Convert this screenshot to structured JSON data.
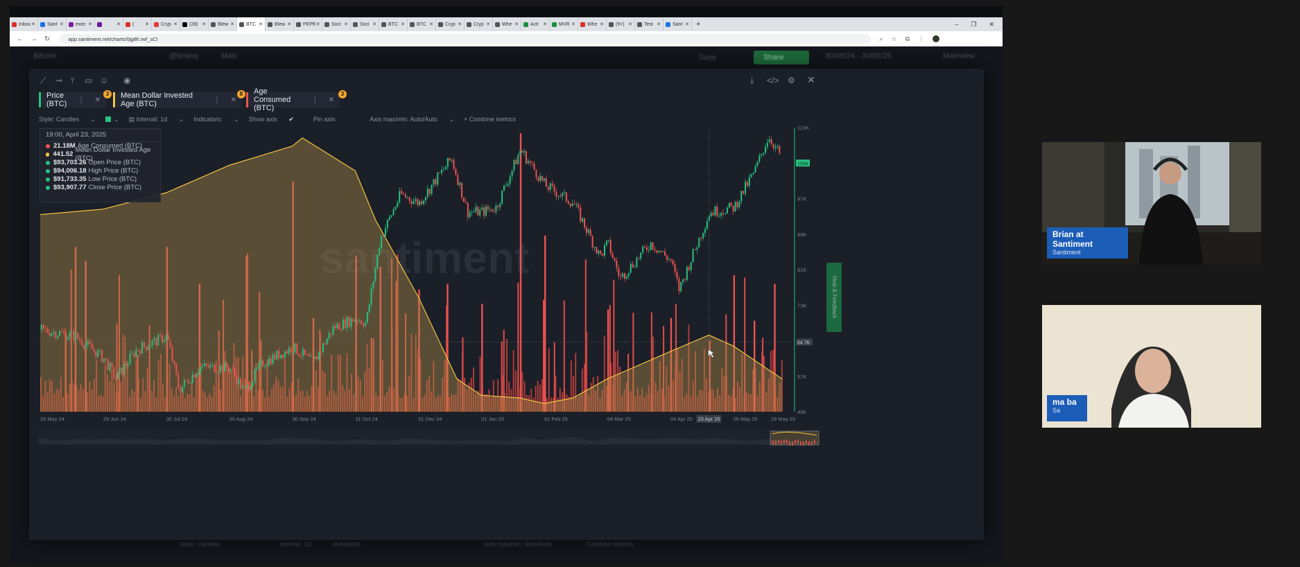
{
  "browser": {
    "tabs": [
      {
        "label": "Inbox",
        "color": "#d93025"
      },
      {
        "label": "Sant",
        "color": "#1a73e8"
      },
      {
        "label": "exec",
        "color": "#7b1fa2"
      },
      {
        "label": "",
        "color": "#6a1b9a"
      },
      {
        "label": "(",
        "color": "#d93025"
      },
      {
        "label": "Cryp",
        "color": "#e53935"
      },
      {
        "label": "(28)",
        "color": "#000000"
      },
      {
        "label": "Blew",
        "color": "#555555"
      },
      {
        "label": "BTC",
        "color": "#555555",
        "active": true
      },
      {
        "label": "Blew",
        "color": "#555555"
      },
      {
        "label": "PEPE",
        "color": "#555555"
      },
      {
        "label": "Soci",
        "color": "#555555"
      },
      {
        "label": "Soci",
        "color": "#555555"
      },
      {
        "label": "BTC",
        "color": "#555555"
      },
      {
        "label": "BTC",
        "color": "#555555"
      },
      {
        "label": "Cryp",
        "color": "#555555"
      },
      {
        "label": "Cryp",
        "color": "#555555"
      },
      {
        "label": "Whe",
        "color": "#555555"
      },
      {
        "label": "Acti",
        "color": "#1e8e3e"
      },
      {
        "label": "MVR",
        "color": "#1e8e3e"
      },
      {
        "label": "Whe",
        "color": "#d93025"
      },
      {
        "label": "(9+)",
        "color": "#555555"
      },
      {
        "label": "Test",
        "color": "#555555"
      },
      {
        "label": "Sant",
        "color": "#1a73e8"
      }
    ],
    "url": "app.santiment.net/charts/0jg8h.iwf_sCl"
  },
  "background_app": {
    "asset": "Bitcoin",
    "user": "@brianq",
    "title": "Main",
    "save": "Save",
    "share": "Share",
    "dates": "30/05/24 - 30/05/25",
    "mainview": "Mainview",
    "style_echo": "Style: Candles",
    "interval_echo": "Interval: 1d",
    "indicators_echo": "Indicators",
    "axis_echo": "Axis max/min: Auto/Auto",
    "combine_echo": "Combine metrics"
  },
  "modal": {
    "metrics": [
      {
        "label": "Price (BTC)",
        "color": "#26c281",
        "badge": "3"
      },
      {
        "label": "Mean Dollar Invested Age (BTC)",
        "color": "#f4c542",
        "badge": "8"
      },
      {
        "label": "Age Consumed (BTC)",
        "color": "#ef5350",
        "badge": "3"
      }
    ],
    "options": {
      "style": "Style: Candles",
      "interval": "Interval: 1d",
      "indicators": "Indicators:",
      "show_axis": "Show axis",
      "pin_axis": "Pin axis",
      "axis_minmax": "Axis max/min: Auto/Auto",
      "combine": "+ Combine metrics"
    },
    "tooltip": {
      "date": "19:00, April 23, 2025",
      "rows": [
        {
          "value": "21.18M",
          "label": "Age Consumed (BTC)",
          "color": "#ef5350"
        },
        {
          "value": "441.52",
          "label": "Mean Dollar Invested Age (BTC)",
          "color": "#f4c542"
        },
        {
          "value": "$93,703.26",
          "label": "Open Price (BTC)",
          "color": "#26c281"
        },
        {
          "value": "$94,006.18",
          "label": "High Price (BTC)",
          "color": "#26c281"
        },
        {
          "value": "$91,733.35",
          "label": "Low Price (BTC)",
          "color": "#26c281"
        },
        {
          "value": "$93,907.77",
          "label": "Close Price (BTC)",
          "color": "#26c281"
        }
      ]
    },
    "feedback_label": "Help & Feedback",
    "watermark": "santiment"
  },
  "chart_data": {
    "type": "line",
    "x_ticks": [
      "29 May 24",
      "29 Jun 24",
      "30 Jul 24",
      "30 Aug 24",
      "30 Sep 24",
      "31 Oct 24",
      "01 Dec 24",
      "01 Jan 25",
      "01 Feb 25",
      "04 Mar 25",
      "04 Apr 25",
      "23 Apr 25",
      "05 May 25",
      "29 May 25"
    ],
    "y_ticks": [
      "113K",
      "105K",
      "97K",
      "89K",
      "81K",
      "73K",
      "64.7K",
      "57K",
      "49K"
    ],
    "ylim": [
      49000,
      113000
    ],
    "current_price_label": "105K",
    "cursor_price_label": "64.7K",
    "cursor_date_label": "23 Apr 25",
    "series": [
      {
        "name": "Price (BTC)",
        "kind": "candles",
        "color_up": "#26c281",
        "color_down": "#ef5350",
        "points": [
          [
            "29 May 24",
            67500
          ],
          [
            "15 Jun 24",
            66000
          ],
          [
            "29 Jun 24",
            61000
          ],
          [
            "05 Jul 24",
            56500
          ],
          [
            "15 Jul 24",
            63000
          ],
          [
            "30 Jul 24",
            66000
          ],
          [
            "05 Aug 24",
            54000
          ],
          [
            "15 Aug 24",
            59000
          ],
          [
            "30 Aug 24",
            59000
          ],
          [
            "06 Sep 24",
            53500
          ],
          [
            "15 Sep 24",
            60000
          ],
          [
            "30 Sep 24",
            63500
          ],
          [
            "10 Oct 24",
            60000
          ],
          [
            "20 Oct 24",
            68000
          ],
          [
            "31 Oct 24",
            70000
          ],
          [
            "05 Nov 24",
            69000
          ],
          [
            "12 Nov 24",
            88000
          ],
          [
            "22 Nov 24",
            98000
          ],
          [
            "01 Dec 24",
            96000
          ],
          [
            "17 Dec 24",
            106000
          ],
          [
            "25 Dec 24",
            94000
          ],
          [
            "01 Jan 25",
            94000
          ],
          [
            "08 Jan 25",
            95000
          ],
          [
            "20 Jan 25",
            108000
          ],
          [
            "01 Feb 25",
            100000
          ],
          [
            "15 Feb 25",
            96000
          ],
          [
            "28 Feb 25",
            84000
          ],
          [
            "04 Mar 25",
            87000
          ],
          [
            "10 Mar 25",
            79000
          ],
          [
            "25 Mar 25",
            87000
          ],
          [
            "04 Apr 25",
            83000
          ],
          [
            "08 Apr 25",
            76500
          ],
          [
            "23 Apr 25",
            93900
          ],
          [
            "05 May 25",
            95000
          ],
          [
            "15 May 25",
            103000
          ],
          [
            "22 May 25",
            111000
          ],
          [
            "29 May 25",
            106000
          ]
        ]
      },
      {
        "name": "Mean Dollar Invested Age (BTC)",
        "kind": "area",
        "color": "#f4c542",
        "points": [
          [
            "29 May 24",
            0.72
          ],
          [
            "29 Jun 24",
            0.74
          ],
          [
            "30 Jul 24",
            0.8
          ],
          [
            "30 Aug 24",
            0.9
          ],
          [
            "30 Sep 24",
            0.97
          ],
          [
            "05 Oct 24",
            1.0
          ],
          [
            "31 Oct 24",
            0.88
          ],
          [
            "10 Nov 24",
            0.7
          ],
          [
            "01 Dec 24",
            0.42
          ],
          [
            "20 Dec 24",
            0.12
          ],
          [
            "01 Jan 25",
            0.06
          ],
          [
            "20 Jan 25",
            0.05
          ],
          [
            "01 Feb 25",
            0.03
          ],
          [
            "15 Feb 25",
            0.05
          ],
          [
            "04 Mar 25",
            0.12
          ],
          [
            "04 Apr 25",
            0.22
          ],
          [
            "23 Apr 25",
            0.28
          ],
          [
            "05 May 25",
            0.24
          ],
          [
            "29 May 25",
            0.12
          ]
        ]
      },
      {
        "name": "Age Consumed (BTC)",
        "kind": "bars",
        "color": "#ef5350",
        "spikes": [
          [
            "15 Jun 24",
            0.58
          ],
          [
            "20 Jun 24",
            0.53
          ],
          [
            "30 Jul 24",
            0.58
          ],
          [
            "15 Aug 24",
            0.45
          ],
          [
            "30 Sep 24",
            0.81
          ],
          [
            "10 Oct 24",
            0.33
          ],
          [
            "31 Oct 24",
            0.55
          ],
          [
            "12 Nov 24",
            0.51
          ],
          [
            "01 Dec 24",
            0.43
          ],
          [
            "15 Dec 24",
            0.45
          ],
          [
            "01 Jan 25",
            0.38
          ],
          [
            "20 Jan 25",
            0.98
          ],
          [
            "01 Feb 25",
            0.62
          ],
          [
            "04 Mar 25",
            0.36
          ],
          [
            "04 Apr 25",
            0.33
          ],
          [
            "23 Apr 25",
            0.25
          ],
          [
            "05 May 25",
            0.48
          ],
          [
            "15 May 25",
            0.32
          ],
          [
            "25 May 25",
            0.45
          ]
        ]
      }
    ]
  },
  "webcams": [
    {
      "name": "Brian at Santiment",
      "org": "Santiment"
    },
    {
      "name": "ma ba",
      "org": "Sa"
    }
  ]
}
